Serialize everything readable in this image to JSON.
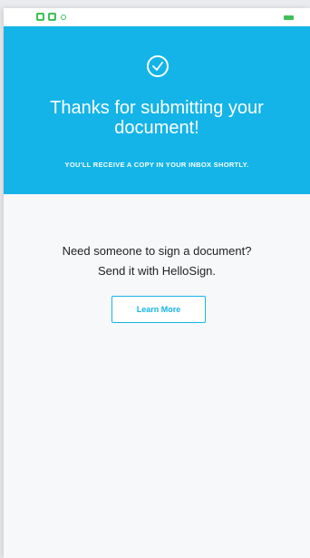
{
  "status_bar": {
    "icons": [
      "notification-icon",
      "message-icon",
      "sync-icon",
      "battery-icon"
    ],
    "accent": "#40c057"
  },
  "hero": {
    "title": "Thanks for submitting your document!",
    "subtitle": "YOU'LL RECEIVE A COPY IN YOUR INBOX SHORTLY.",
    "icon": "checkmark-circle-icon",
    "background": "#14b4e8"
  },
  "promo": {
    "line1": "Need someone to sign a document?",
    "line2": "Send it with HelloSign.",
    "button_label": "Learn More"
  }
}
